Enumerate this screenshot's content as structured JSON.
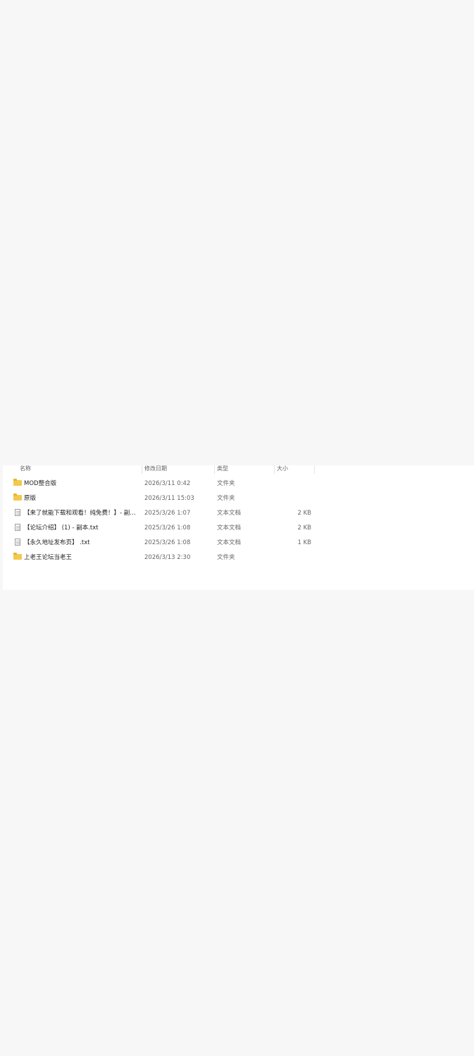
{
  "columns": {
    "name": "名称",
    "date": "修改日期",
    "type": "类型",
    "size": "大小"
  },
  "files": [
    {
      "icon": "folder-icon",
      "name": "MOD整合版",
      "date": "2026/3/11 0:42",
      "type": "文件夹",
      "size": ""
    },
    {
      "icon": "folder-icon",
      "name": "原版",
      "date": "2026/3/11 15:03",
      "type": "文件夹",
      "size": ""
    },
    {
      "icon": "text-file-icon",
      "name": "【来了就能下载和观看！纯免费！】- 副本.txt",
      "date": "2025/3/26 1:07",
      "type": "文本文档",
      "size": "2 KB"
    },
    {
      "icon": "text-file-icon",
      "name": "【论坛介绍】 (1) - 副本.txt",
      "date": "2025/3/26 1:08",
      "type": "文本文档",
      "size": "2 KB"
    },
    {
      "icon": "text-file-icon",
      "name": "【永久地址发布页】 .txt",
      "date": "2025/3/26 1:08",
      "type": "文本文档",
      "size": "1 KB"
    },
    {
      "icon": "folder-icon",
      "name": "上老王论坛当老王",
      "date": "2026/3/13 2:30",
      "type": "文件夹",
      "size": ""
    }
  ]
}
